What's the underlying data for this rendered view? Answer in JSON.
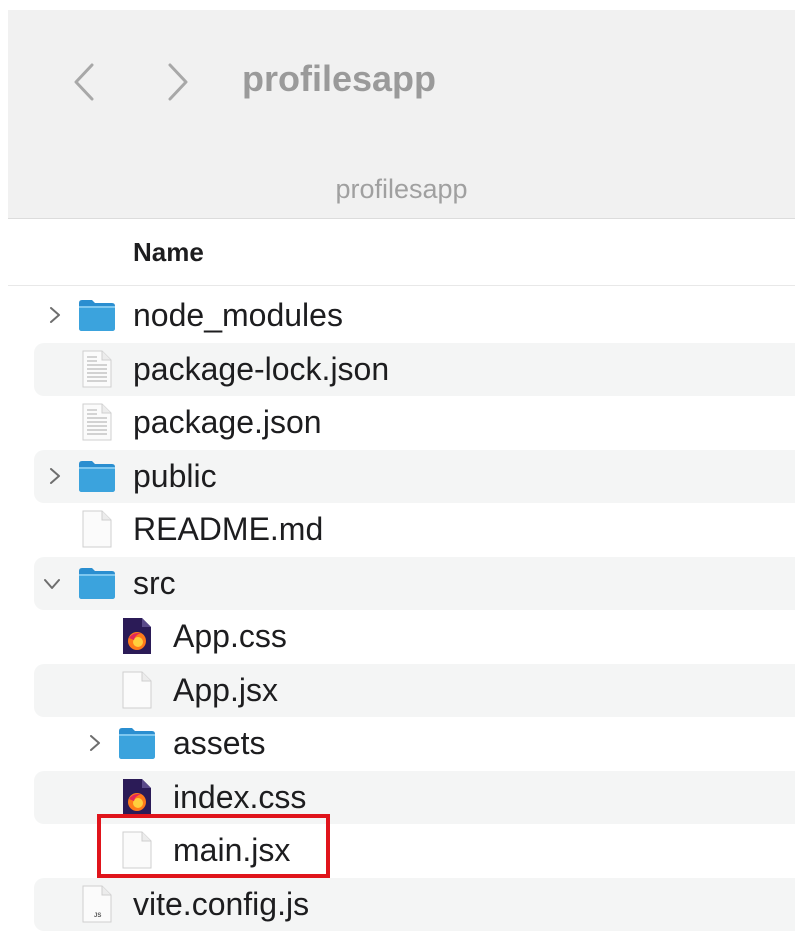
{
  "window": {
    "title": "profilesapp",
    "path_label": "profilesapp"
  },
  "nav": {
    "back_icon": "chevron-left-icon",
    "forward_icon": "chevron-right-icon"
  },
  "list": {
    "column_name": "Name",
    "rows": [
      {
        "name": "node_modules",
        "kind": "folder",
        "level": 0,
        "disclosure": "collapsed"
      },
      {
        "name": "package-lock.json",
        "kind": "json-file",
        "level": 0
      },
      {
        "name": "package.json",
        "kind": "json-file",
        "level": 0
      },
      {
        "name": "public",
        "kind": "folder",
        "level": 0,
        "disclosure": "collapsed"
      },
      {
        "name": "README.md",
        "kind": "blank-file",
        "level": 0
      },
      {
        "name": "src",
        "kind": "folder",
        "level": 0,
        "disclosure": "expanded"
      },
      {
        "name": "App.css",
        "kind": "css-file",
        "level": 1
      },
      {
        "name": "App.jsx",
        "kind": "blank-file",
        "level": 1
      },
      {
        "name": "assets",
        "kind": "folder",
        "level": 1,
        "disclosure": "collapsed"
      },
      {
        "name": "index.css",
        "kind": "css-file",
        "level": 1
      },
      {
        "name": "main.jsx",
        "kind": "blank-file",
        "level": 1,
        "highlighted": true
      },
      {
        "name": "vite.config.js",
        "kind": "js-file",
        "level": 0
      }
    ]
  },
  "highlight_color": "#e0141b",
  "folder_color": "#3ba3dd"
}
